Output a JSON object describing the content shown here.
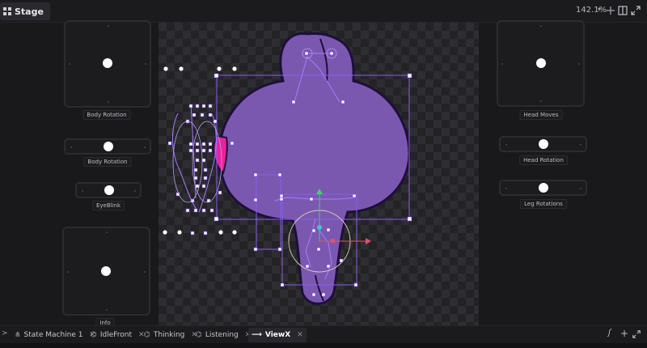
{
  "header": {
    "stage_label": "Stage",
    "zoom_level": "142.1%",
    "icons": [
      "grid-icon",
      "split-view-icon",
      "expand-icon"
    ]
  },
  "controls": {
    "body_rotation_pad": "Body Rotation",
    "body_rotation_slider": "Body  Rotation",
    "eyeblink": "EyeBlink",
    "info": "Info",
    "head_moves": "Head Moves",
    "head_rotation": "Head Rotation",
    "leg_rotations": "Leg Rotations"
  },
  "tabs": [
    {
      "label": "State Machine 1",
      "icon": "state-machine-icon",
      "active": false
    },
    {
      "label": "IdleFront",
      "icon": "timeline-icon",
      "active": false
    },
    {
      "label": "Thinking",
      "icon": "timeline-icon",
      "active": false
    },
    {
      "label": "Listening",
      "icon": "timeline-icon",
      "active": false
    },
    {
      "label": "ViewX",
      "icon": "arrow-right-icon",
      "active": true
    }
  ],
  "colors": {
    "character_fill": "#7b58b0",
    "character_outline": "#1e0f3a",
    "accent_pink": "#e8249a",
    "bone": "#8a5cf0",
    "background": "#141416"
  }
}
